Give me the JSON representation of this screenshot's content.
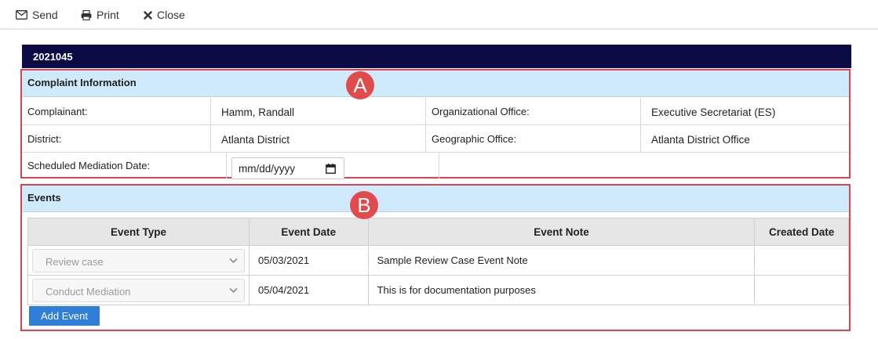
{
  "toolbar": {
    "send_label": "Send",
    "print_label": "Print",
    "close_label": "Close"
  },
  "case": {
    "number": "2021045"
  },
  "complaint": {
    "heading": "Complaint Information",
    "complainant_label": "Complainant:",
    "complainant_value": "Hamm, Randall",
    "org_office_label": "Organizational Office:",
    "org_office_value": "Executive Secretariat (ES)",
    "district_label": "District:",
    "district_value": "Atlanta District",
    "geo_office_label": "Geographic Office:",
    "geo_office_value": "Atlanta District Office",
    "mediation_label": "Scheduled Mediation Date:",
    "mediation_placeholder": "mm/dd/yyyy"
  },
  "badges": {
    "a": "A",
    "b": "B"
  },
  "events": {
    "heading": "Events",
    "columns": [
      "Event Type",
      "Event Date",
      "Event Note",
      "Created Date"
    ],
    "rows": [
      {
        "type": "Review case",
        "date": "05/03/2021",
        "note": "Sample Review Case Event Note",
        "created": ""
      },
      {
        "type": "Conduct Mediation",
        "date": "05/04/2021",
        "note": "This is for documentation purposes",
        "created": ""
      }
    ],
    "add_label": "Add Event"
  },
  "colors": {
    "header_bar": "#0b0b45",
    "section_header_bg": "#cfeafb",
    "annotation_red": "#d9444e",
    "button_blue": "#2f7ed8"
  },
  "icons": {
    "send": "envelope-icon",
    "print": "printer-icon",
    "close": "x-icon",
    "calendar": "calendar-icon",
    "select": "chevron-down-icon"
  }
}
